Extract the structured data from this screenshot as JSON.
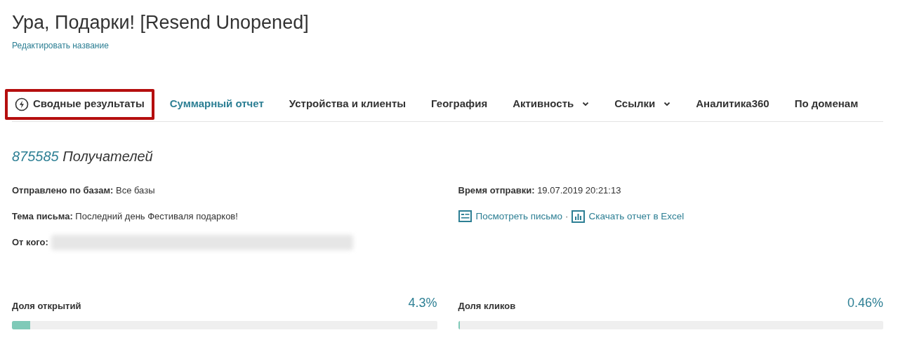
{
  "title": "Ура, Подарки! [Resend Unopened]",
  "edit_link": "Редактировать название",
  "tabs": [
    {
      "label": "Сводные результаты",
      "selected": false,
      "annotated": true,
      "dropdown": false
    },
    {
      "label": "Суммарный отчет",
      "selected": true,
      "annotated": false,
      "dropdown": false
    },
    {
      "label": "Устройства и клиенты",
      "selected": false,
      "annotated": false,
      "dropdown": false
    },
    {
      "label": "География",
      "selected": false,
      "annotated": false,
      "dropdown": false
    },
    {
      "label": "Активность",
      "selected": false,
      "annotated": false,
      "dropdown": true
    },
    {
      "label": "Ссылки",
      "selected": false,
      "annotated": false,
      "dropdown": true
    },
    {
      "label": "Аналитика360",
      "selected": false,
      "annotated": false,
      "dropdown": false
    },
    {
      "label": "По доменам",
      "selected": false,
      "annotated": false,
      "dropdown": false
    }
  ],
  "recipients": {
    "count": "875585",
    "label": "Получателей"
  },
  "details_left": [
    {
      "label": "Отправлено по базам:",
      "value": "Все базы"
    },
    {
      "label": "Тема письма:",
      "value": "Последний день Фестиваля подарков!"
    },
    {
      "label": "От кого:",
      "redacted": true
    }
  ],
  "details_right": [
    {
      "label": "Время отправки:",
      "value": "19.07.2019 20:21:13"
    }
  ],
  "links": [
    {
      "kind": "view",
      "label": "Посмотреть письмо"
    },
    {
      "kind": "excel",
      "label": "Скачать отчет в Excel"
    }
  ],
  "link_separator": "·",
  "rates": [
    {
      "label": "Доля открытий",
      "reading": "4.3%",
      "level": 0.043
    },
    {
      "label": "Доля кликов",
      "reading": "0.46%",
      "level": 0.0046
    }
  ]
}
